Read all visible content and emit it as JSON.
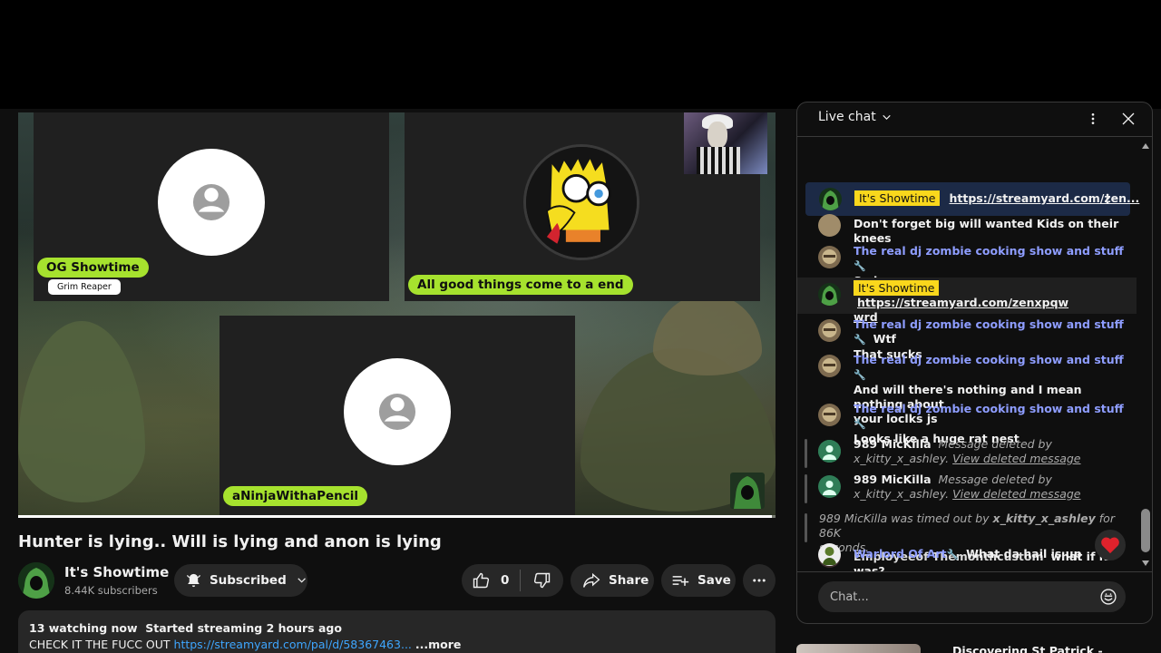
{
  "video": {
    "participants": [
      {
        "name": "OG Showtime",
        "subtitle": "Grim Reaper"
      },
      {
        "name": "All good things come to a end"
      },
      {
        "name": "aNinjaWithaPencil"
      }
    ],
    "progress": 0.995
  },
  "meta": {
    "title": "Hunter is lying.. Will is lying and anon is lying",
    "channel": "It's Showtime",
    "subscribers": "8.44K subscribers",
    "subscribe_label": "Subscribed",
    "likes": "0",
    "share_label": "Share",
    "save_label": "Save"
  },
  "description": {
    "watching": "13 watching now",
    "started": "Started streaming 2 hours ago",
    "text": "CHECK IT THE FUCC OUT",
    "link": "https://streamyard.com/pal/d/58367463...",
    "more": "...more"
  },
  "chat": {
    "title": "Live chat",
    "placeholder": "Chat...",
    "pinned": {
      "badge": "It's Showtime",
      "link": "https://streamyard.com/zen..."
    },
    "messages": [
      {
        "author": "The real dj zombie cooking show and stuff",
        "text": "Don't forget big will wanted Kids on their knees"
      },
      {
        "author": "The real dj zombie cooking show and stuff",
        "text": "Smh"
      },
      {
        "badge": "It's Showtime",
        "link1": "https://streamyard.com/zenxpqw",
        "link2": "wrd"
      },
      {
        "author": "The real dj zombie cooking show and stuff",
        "text": "Wtf",
        "text2": "That sucks"
      },
      {
        "author": "The real dj zombie cooking show and stuff",
        "text": "And will there's nothing and I mean nothing about",
        "text2": "your loclks js"
      },
      {
        "author": "The real dj zombie cooking show and stuff",
        "text": "Looks like a huge rat nest"
      },
      {
        "author": "989 MicKilla",
        "deleted": "Message deleted by",
        "by": "x_kitty_x_ashley.",
        "view": "View deleted message"
      },
      {
        "author": "989 MicKilla",
        "deleted": "Message deleted by",
        "by": "x_kitty_x_ashley.",
        "view": "View deleted message"
      },
      {
        "timeout_user": "989 MicKilla",
        "timeout_mid": "was timed out by",
        "timeout_by": "x_kitty_x_ashley",
        "timeout_end": "for 86K",
        "timeout_end2": "seconds."
      },
      {
        "author": "Employeeof Themonthcustom",
        "text": "what if it was?"
      },
      {
        "author": "Warlord Of Art",
        "text": "What da hail is up"
      }
    ]
  },
  "recommendation": {
    "title": "Discovering St Patrick -"
  }
}
